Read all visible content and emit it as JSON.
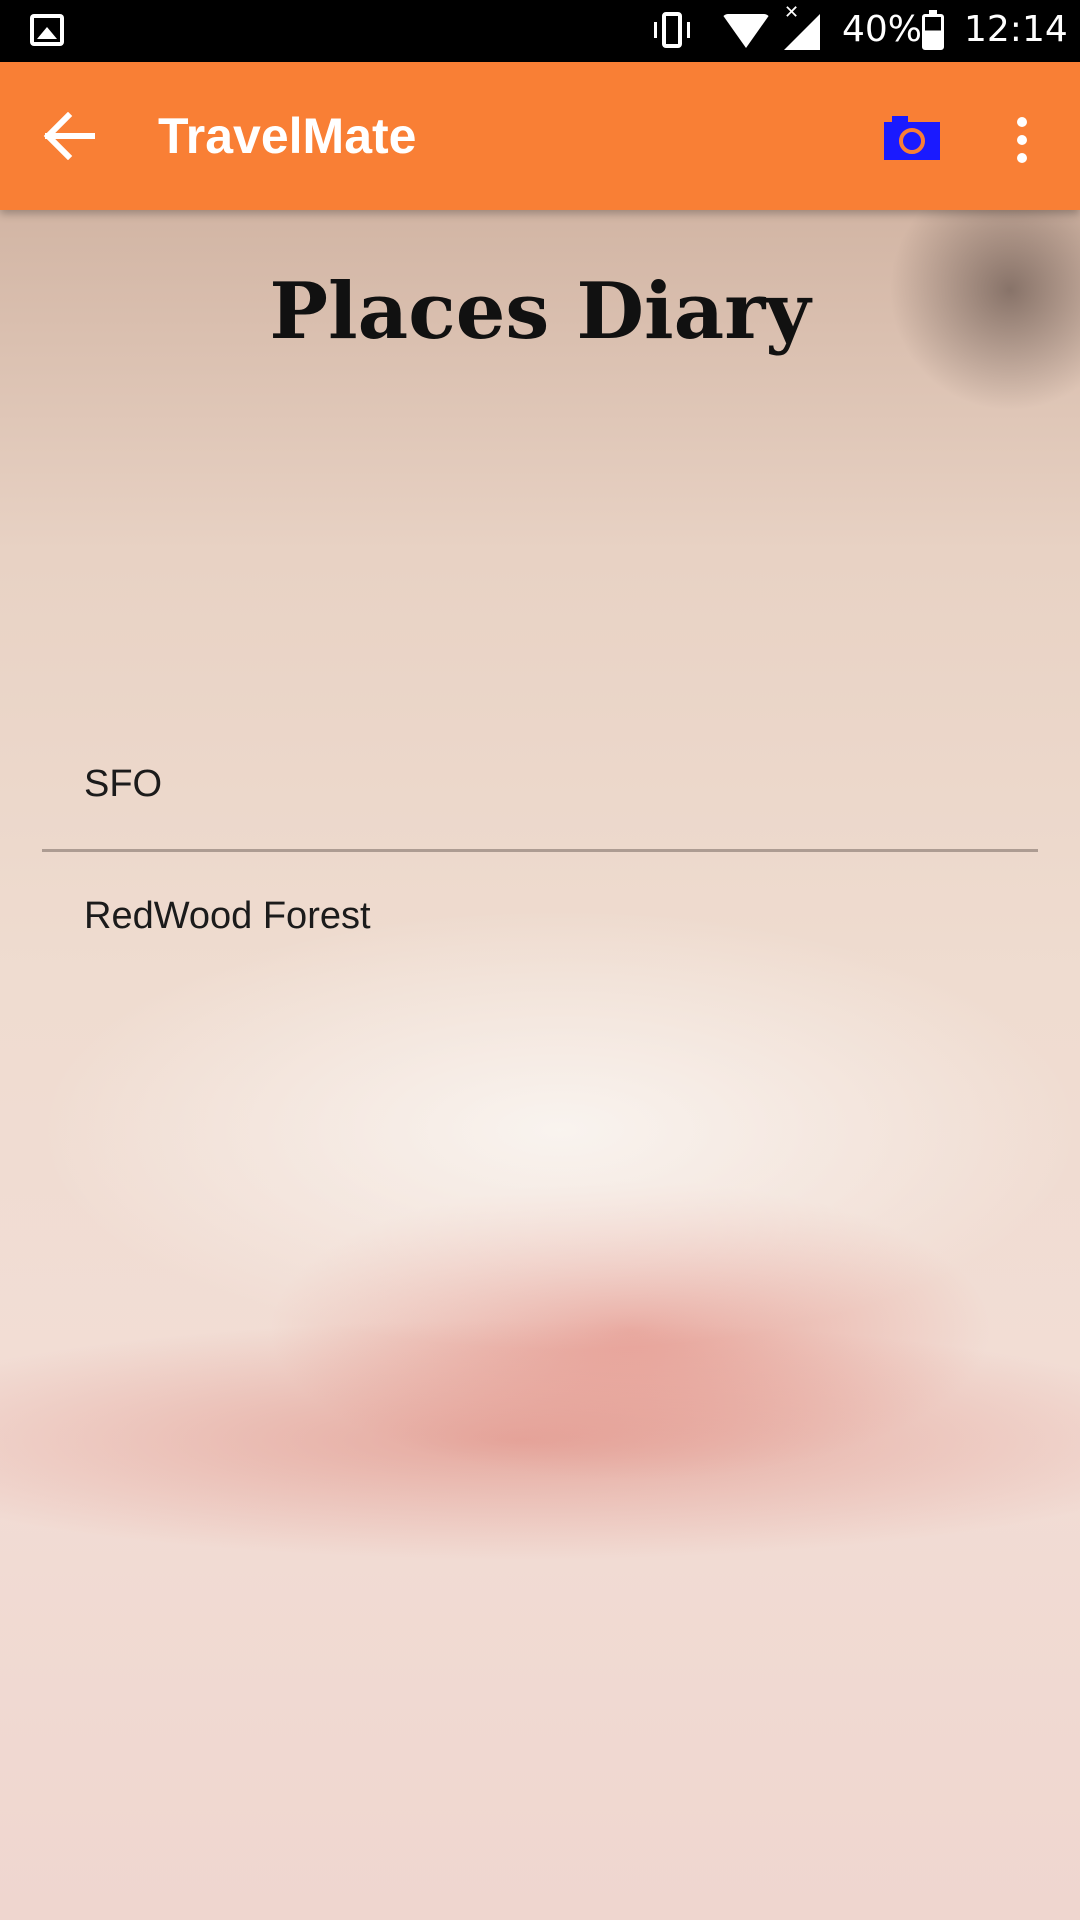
{
  "status_bar": {
    "battery_text": "40%",
    "time": "12:14",
    "icons": [
      "gallery-notification-icon",
      "vibrate-icon",
      "wifi-icon",
      "signal-icon",
      "battery-icon"
    ]
  },
  "app_bar": {
    "title": "TravelMate",
    "icons": [
      "back-arrow-icon",
      "camera-icon",
      "overflow-menu-icon"
    ],
    "colors": {
      "background": "#f97f35",
      "camera": "#1a1aff"
    }
  },
  "main": {
    "heading": "Places Diary",
    "places": [
      {
        "name": "SFO"
      },
      {
        "name": "RedWood Forest"
      }
    ]
  }
}
